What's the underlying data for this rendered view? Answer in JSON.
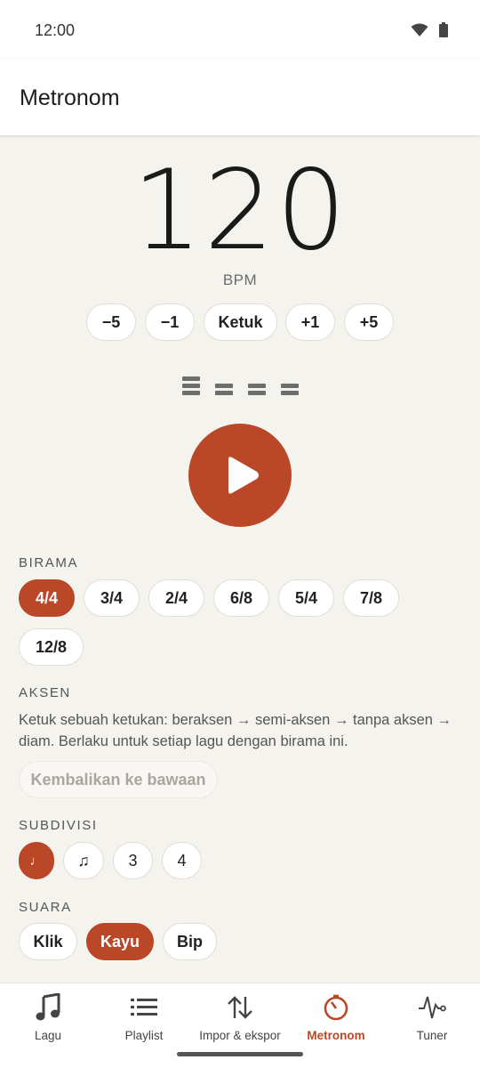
{
  "status": {
    "time": "12:00",
    "icons": [
      "wifi-icon",
      "battery-icon"
    ]
  },
  "app_bar": {
    "title": "Metronom"
  },
  "tempo": {
    "bpm": "120",
    "unit": "BPM",
    "buttons": [
      "−5",
      "−1",
      "Ketuk",
      "+1",
      "+5"
    ]
  },
  "beats": {
    "count": 4,
    "accents": [
      "accent",
      "semi",
      "semi",
      "semi"
    ]
  },
  "play": {
    "icon": "play-icon"
  },
  "birama": {
    "label": "BIRAMA",
    "options": [
      "4/4",
      "3/4",
      "2/4",
      "6/8",
      "5/4",
      "7/8",
      "12/8"
    ],
    "selected": "4/4"
  },
  "aksen": {
    "label": "AKSEN",
    "description": "Ketuk sebuah ketukan: beraksen → semi-aksen → tanpa aksen → diam. Berlaku untuk setiap lagu dengan birama ini.",
    "reset_label": "Kembalikan ke bawaan"
  },
  "subdivisi": {
    "label": "SUBDIVISI",
    "options": [
      "♩",
      "♫",
      "3",
      "4"
    ],
    "selected": "♩"
  },
  "suara": {
    "label": "SUARA",
    "options": [
      "Klik",
      "Kayu",
      "Bip"
    ],
    "selected": "Kayu"
  },
  "nav": {
    "items": [
      {
        "label": "Lagu",
        "icon": "music-note-icon"
      },
      {
        "label": "Playlist",
        "icon": "list-icon"
      },
      {
        "label": "Impor & ekspor",
        "icon": "import-export-icon"
      },
      {
        "label": "Metronom",
        "icon": "metronome-icon",
        "active": true
      },
      {
        "label": "Tuner",
        "icon": "tuner-wave-icon"
      }
    ]
  },
  "colors": {
    "accent": "#b94728",
    "background": "#f5f3ee",
    "surface": "#ffffff"
  }
}
